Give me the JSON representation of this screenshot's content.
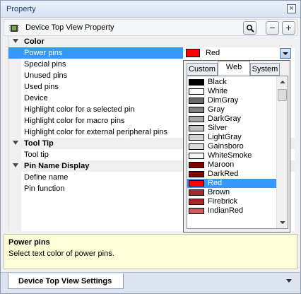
{
  "window": {
    "title": "Property"
  },
  "header": {
    "title": "Device Top View Property",
    "search_icon": "magnifier-icon",
    "collapse_label": "−",
    "expand_label": "+"
  },
  "grid": {
    "rows": [
      {
        "kind": "category",
        "label": "Color"
      },
      {
        "kind": "prop",
        "label": "Power pins",
        "selected": true
      },
      {
        "kind": "prop",
        "label": "Special pins"
      },
      {
        "kind": "prop",
        "label": "Unused pins"
      },
      {
        "kind": "prop",
        "label": "Used pins"
      },
      {
        "kind": "prop",
        "label": "Device"
      },
      {
        "kind": "prop",
        "label": "Highlight color for a selected pin"
      },
      {
        "kind": "prop",
        "label": "Highlight color for macro pins"
      },
      {
        "kind": "prop",
        "label": "Highlight color for external peripheral pins"
      },
      {
        "kind": "category",
        "label": "Tool Tip"
      },
      {
        "kind": "prop",
        "label": "Tool tip"
      },
      {
        "kind": "category",
        "label": "Pin Name Display"
      },
      {
        "kind": "prop",
        "label": "Define name"
      },
      {
        "kind": "prop",
        "label": "Pin function"
      }
    ],
    "value": {
      "text": "Red",
      "color": "#ff0000"
    }
  },
  "popup": {
    "tabs": [
      "Custom",
      "Web",
      "System"
    ],
    "active_tab": "Web",
    "colors": [
      {
        "name": "Black",
        "hex": "#000000"
      },
      {
        "name": "White",
        "hex": "#ffffff"
      },
      {
        "name": "DimGray",
        "hex": "#696969"
      },
      {
        "name": "Gray",
        "hex": "#808080"
      },
      {
        "name": "DarkGray",
        "hex": "#a9a9a9"
      },
      {
        "name": "Silver",
        "hex": "#c0c0c0"
      },
      {
        "name": "LightGray",
        "hex": "#d3d3d3"
      },
      {
        "name": "Gainsboro",
        "hex": "#dcdcdc"
      },
      {
        "name": "WhiteSmoke",
        "hex": "#f5f5f5"
      },
      {
        "name": "Maroon",
        "hex": "#800000"
      },
      {
        "name": "DarkRed",
        "hex": "#8b0000"
      },
      {
        "name": "Red",
        "hex": "#ff0000",
        "selected": true
      },
      {
        "name": "Brown",
        "hex": "#a52a2a"
      },
      {
        "name": "Firebrick",
        "hex": "#b22222"
      },
      {
        "name": "IndianRed",
        "hex": "#cd5c5c"
      }
    ]
  },
  "help": {
    "title": "Power pins",
    "description": "Select text color of power pins."
  },
  "bottom": {
    "tab_label": "Device Top View Settings"
  }
}
